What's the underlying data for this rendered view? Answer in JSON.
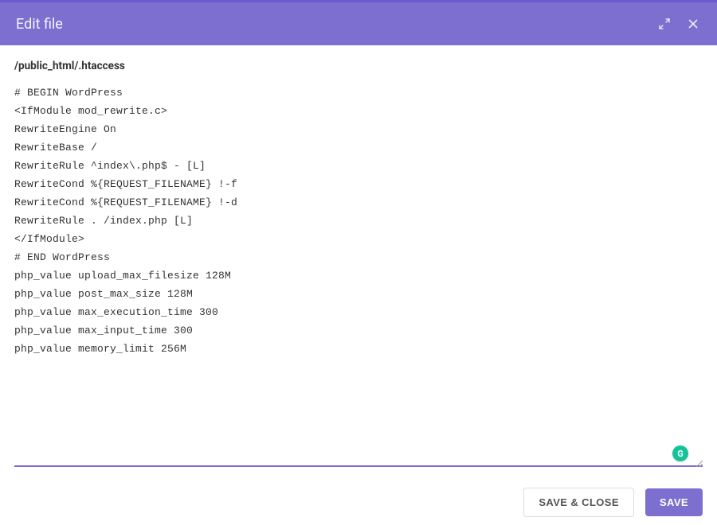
{
  "header": {
    "title": "Edit file",
    "expand_icon": "expand-icon",
    "close_icon": "close-icon"
  },
  "file": {
    "path": "/public_html/.htaccess"
  },
  "editor": {
    "content": "# BEGIN WordPress\n<IfModule mod_rewrite.c>\nRewriteEngine On\nRewriteBase /\nRewriteRule ^index\\.php$ - [L]\nRewriteCond %{REQUEST_FILENAME} !-f\nRewriteCond %{REQUEST_FILENAME} !-d\nRewriteRule . /index.php [L]\n</IfModule>\n# END WordPress\nphp_value upload_max_filesize 128M\nphp_value post_max_size 128M\nphp_value max_execution_time 300\nphp_value max_input_time 300\nphp_value memory_limit 256M"
  },
  "footer": {
    "save_close_label": "SAVE & CLOSE",
    "save_label": "SAVE"
  },
  "badge": {
    "label": "G"
  },
  "colors": {
    "accent": "#7c6fcf",
    "badge": "#15c39a"
  }
}
